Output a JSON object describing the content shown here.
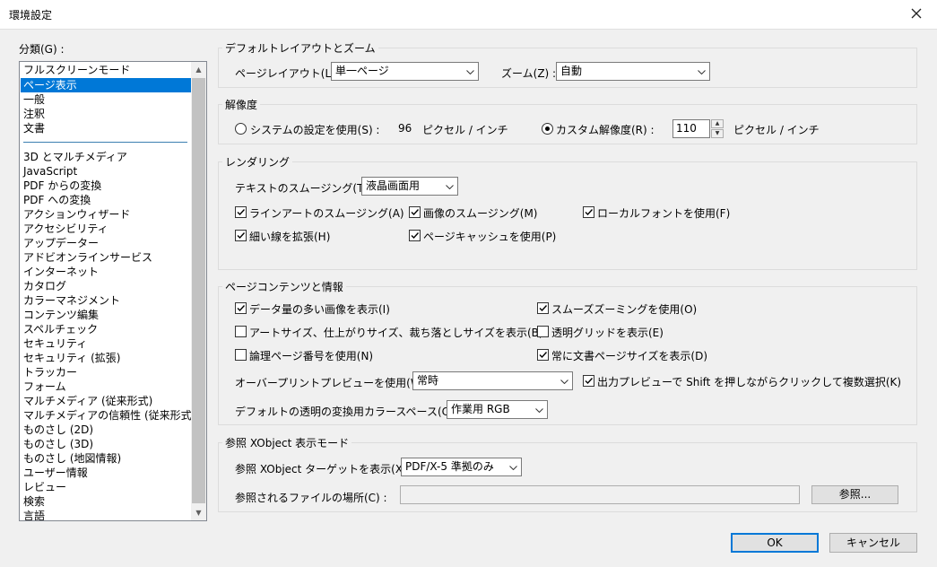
{
  "window": {
    "title": "環境設定"
  },
  "categories": {
    "label": "分類(G) :",
    "selected": "ページ表示",
    "top_items": [
      "フルスクリーンモード",
      "ページ表示",
      "一般",
      "注釈",
      "文書"
    ],
    "items": [
      "3D とマルチメディア",
      "JavaScript",
      "PDF からの変換",
      "PDF への変換",
      "アクションウィザード",
      "アクセシビリティ",
      "アップデーター",
      "アドビオンラインサービス",
      "インターネット",
      "カタログ",
      "カラーマネジメント",
      "コンテンツ編集",
      "スペルチェック",
      "セキュリティ",
      "セキュリティ (拡張)",
      "トラッカー",
      "フォーム",
      "マルチメディア (従来形式)",
      "マルチメディアの信頼性 (従来形式)",
      "ものさし (2D)",
      "ものさし (3D)",
      "ものさし (地図情報)",
      "ユーザー情報",
      "レビュー",
      "検索",
      "言語"
    ]
  },
  "layout_zoom": {
    "title": "デフォルトレイアウトとズーム",
    "page_layout_label": "ページレイアウト(L) :",
    "page_layout_value": "単一ページ",
    "zoom_label": "ズーム(Z) :",
    "zoom_value": "自動"
  },
  "resolution": {
    "title": "解像度",
    "system_label": "システムの設定を使用(S) :",
    "system_value": "96",
    "system_unit": "ピクセル / インチ",
    "custom_label": "カスタム解像度(R) :",
    "custom_value": "110",
    "custom_unit": "ピクセル / インチ",
    "selected": "custom"
  },
  "rendering": {
    "title": "レンダリング",
    "smoothing_label": "テキストのスムージング(T) :",
    "smoothing_value": "液晶画面用",
    "options": [
      {
        "label": "ラインアートのスムージング(A)",
        "checked": true
      },
      {
        "label": "画像のスムージング(M)",
        "checked": true
      },
      {
        "label": "ローカルフォントを使用(F)",
        "checked": true
      },
      {
        "label": "細い線を拡張(H)",
        "checked": true
      },
      {
        "label": "ページキャッシュを使用(P)",
        "checked": true
      }
    ]
  },
  "content": {
    "title": "ページコンテンツと情報",
    "options": [
      {
        "label": "データ量の多い画像を表示(I)",
        "checked": true
      },
      {
        "label": "スムーズズーミングを使用(O)",
        "checked": true
      },
      {
        "label": "アートサイズ、仕上がりサイズ、裁ち落としサイズを表示(B)",
        "checked": false
      },
      {
        "label": "透明グリッドを表示(E)",
        "checked": false
      },
      {
        "label": "論理ページ番号を使用(N)",
        "checked": false
      },
      {
        "label": "常に文書ページサイズを表示(D)",
        "checked": true
      },
      {
        "label": "出力プレビューで Shift を押しながらクリックして複数選択(K)",
        "checked": true
      }
    ],
    "overprint_label": "オーバープリントプレビューを使用(W) :",
    "overprint_value": "常時",
    "colorspace_label": "デフォルトの透明の変換用カラースペース(C) :",
    "colorspace_value": "作業用 RGB"
  },
  "xobject": {
    "title": "参照 XObject 表示モード",
    "target_label": "参照 XObject ターゲットを表示(X) :",
    "target_value": "PDF/X-5 準拠のみ",
    "location_label": "参照されるファイルの場所(C) :",
    "location_value": "",
    "browse_label": "参照..."
  },
  "buttons": {
    "ok": "OK",
    "cancel": "キャンセル"
  }
}
